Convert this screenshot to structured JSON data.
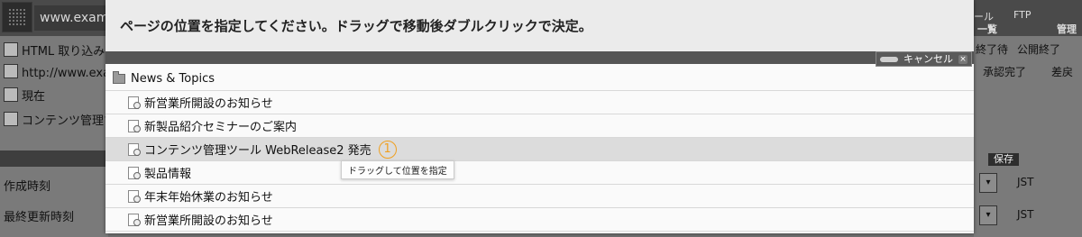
{
  "background": {
    "url_text": "www.examp",
    "rows": [
      "HTML 取り込み",
      "http://www.exa",
      "現在",
      "コンテンツ管理ツ"
    ],
    "labels": [
      "作成時刻",
      "最終更新時刻"
    ],
    "top_right": {
      "ftp": "FTP",
      "left_label": "ール",
      "ichiran": "一覧",
      "kanri": "管理"
    },
    "status": {
      "wait": "終了待",
      "public_end": "公開終了",
      "approved": "承認完了",
      "sashimodoshi": "差戻"
    },
    "save_label": "保存",
    "jst": "JST"
  },
  "modal": {
    "title": "ページの位置を指定してください。ドラッグで移動後ダブルクリックで決定。",
    "cancel_label": "キャンセル",
    "cancel_x": "×",
    "folder": "News & Topics",
    "items": [
      {
        "label": "新営業所開設のお知らせ"
      },
      {
        "label": "新製品紹介セミナーのご案内"
      },
      {
        "label": "コンテンツ管理ツール WebRelease2 発売",
        "marker": "1"
      },
      {
        "label": "製品情報"
      },
      {
        "label": "年末年始休業のお知らせ"
      },
      {
        "label": "新営業所開設のお知らせ"
      }
    ],
    "tooltip": "ドラッグして位置を指定"
  },
  "colors": {
    "marker": "#f0a020",
    "modal_bg": "#fafafa",
    "overlay": "#6f6f6f"
  }
}
